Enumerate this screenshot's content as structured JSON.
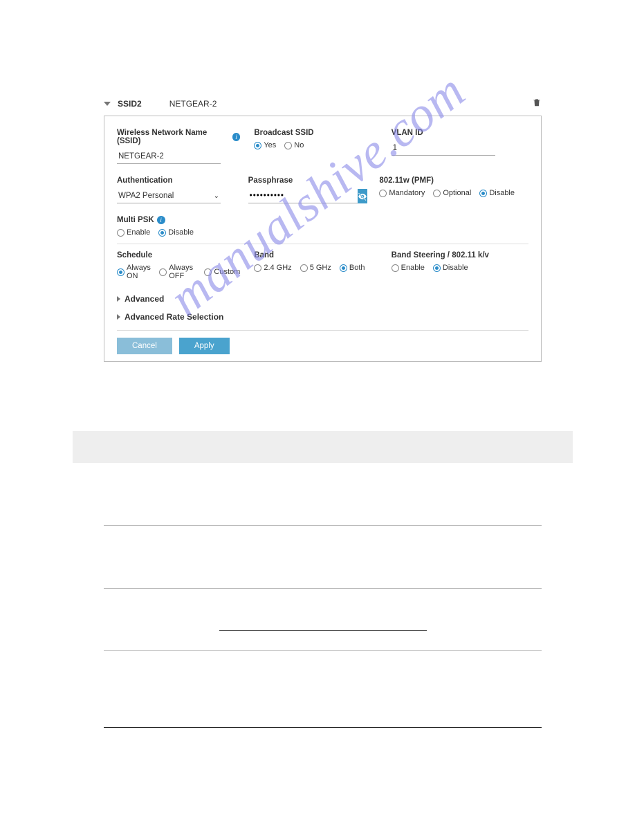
{
  "header": {
    "ssid_label": "SSID2",
    "ssid_name": "NETGEAR-2"
  },
  "fields": {
    "ssid_name_label": "Wireless Network Name (SSID)",
    "ssid_name_value": "NETGEAR-2",
    "broadcast_ssid_label": "Broadcast SSID",
    "broadcast_yes": "Yes",
    "broadcast_no": "No",
    "vlan_label": "VLAN ID",
    "vlan_value": "1",
    "auth_label": "Authentication",
    "auth_value": "WPA2 Personal",
    "passphrase_label": "Passphrase",
    "passphrase_value": "••••••••••",
    "pmf_label": "802.11w (PMF)",
    "pmf_mandatory": "Mandatory",
    "pmf_optional": "Optional",
    "pmf_disable": "Disable",
    "multipsk_label": "Multi PSK",
    "multipsk_enable": "Enable",
    "multipsk_disable": "Disable",
    "schedule_label": "Schedule",
    "schedule_always_on": "Always ON",
    "schedule_always_off": "Always OFF",
    "schedule_custom": "Custom",
    "band_label": "Band",
    "band_24": "2.4 GHz",
    "band_5": "5 GHz",
    "band_both": "Both",
    "steering_label": "Band Steering / 802.11 k/v",
    "steering_enable": "Enable",
    "steering_disable": "Disable"
  },
  "expand": {
    "advanced": "Advanced",
    "advanced_rate": "Advanced Rate Selection"
  },
  "buttons": {
    "cancel": "Cancel",
    "apply": "Apply"
  },
  "watermark": "manualshive.com"
}
